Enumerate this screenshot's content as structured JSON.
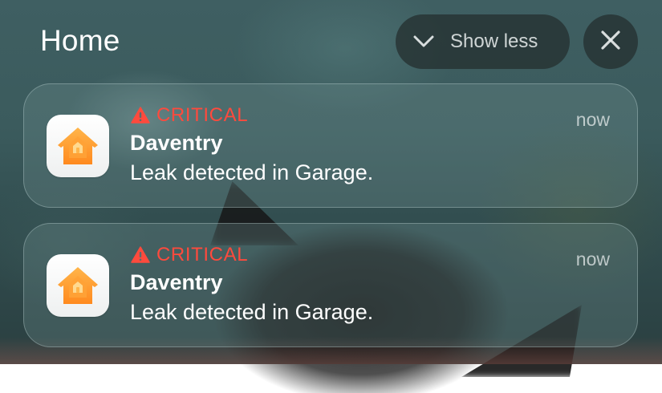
{
  "header": {
    "title": "Home"
  },
  "controls": {
    "show_less_label": "Show less",
    "show_less_icon": "chevron-down-icon",
    "close_icon": "close-icon"
  },
  "notifications": [
    {
      "app_icon": "home-app-icon",
      "severity_icon": "warning-icon",
      "severity": "CRITICAL",
      "severity_color": "#ff4a3d",
      "title": "Daventry",
      "body": "Leak detected in Garage.",
      "time": "now"
    },
    {
      "app_icon": "home-app-icon",
      "severity_icon": "warning-icon",
      "severity": "CRITICAL",
      "severity_color": "#ff4a3d",
      "title": "Daventry",
      "body": "Leak detected in Garage.",
      "time": "now"
    }
  ]
}
